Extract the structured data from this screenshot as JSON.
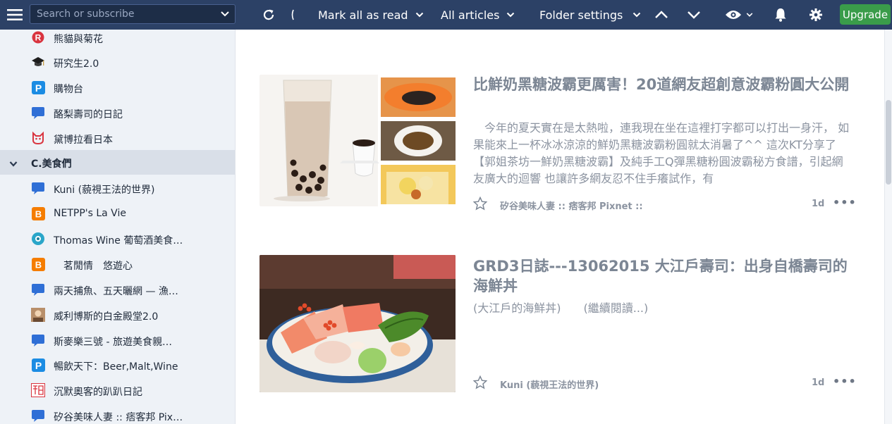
{
  "toolbar": {
    "search_placeholder": "Search or subscribe",
    "mark_all_read": "Mark all as read",
    "all_articles": "All articles",
    "folder_settings": "Folder settings",
    "upgrade": "Upgrade",
    "icons": [
      "hamburger-icon",
      "refresh-icon",
      "chevron-up-icon",
      "chevron-down-icon",
      "eye-icon",
      "bell-icon",
      "gear-icon"
    ],
    "upgrade_color": "#3a9c4a",
    "bar_color": "#2c4166"
  },
  "sidebar": {
    "feeds_before": [
      {
        "label": "熊貓與菊花",
        "icon": "R"
      },
      {
        "label": "研究生2.0",
        "icon": "cap"
      },
      {
        "label": "購物台",
        "icon": "P"
      },
      {
        "label": "酪梨壽司的日記",
        "icon": "bubble"
      },
      {
        "label": "黛博拉看日本",
        "icon": "cat"
      }
    ],
    "folder": {
      "label": "C.美食們"
    },
    "feeds_after": [
      {
        "label": "Kuni (藐視王法的世界)",
        "icon": "bubble"
      },
      {
        "label": "NETPP's La Vie",
        "icon": "blogger"
      },
      {
        "label": "Thomas Wine 葡萄酒美食…",
        "icon": "wine"
      },
      {
        "label": "　茗閒情　悠遊心",
        "icon": "blogger"
      },
      {
        "label": "兩天捕魚、五天曬網 — 漁…",
        "icon": "bubble"
      },
      {
        "label": "威利博斯的白金殿堂2.0",
        "icon": "photo"
      },
      {
        "label": "斯麥樂三號 - 旅遊美食親…",
        "icon": "bubble"
      },
      {
        "label": "暢飲天下：Beer,Malt,Wine",
        "icon": "P"
      },
      {
        "label": "沉默奧客的趴趴日記",
        "icon": "seal"
      },
      {
        "label": "矽谷美味人妻 :: 痞客邦 Pix…",
        "icon": "bubble"
      }
    ]
  },
  "articles": [
    {
      "title": "比鮮奶黑糖波霸更厲害！20道網友超創意波霸粉圓大公開",
      "snippet": "　今年的夏天實在是太熱啦，連我現在坐在這裡打字都可以打出一身汗，  如果能來上一杯冰冰涼涼的鮮奶黑糖波霸粉圓就太消暑了^^  這次KT分享了【郭姐茶坊一鮮奶黑糖波霸】及純手工Q彈黑糖粉圓波霸秘方食譜，引起網友廣大的迴響  也讓許多網友忍不住手癢試作，有",
      "source": "矽谷美味人妻 :: 痞客邦 Pixnet ::",
      "date": "1d",
      "more": "•••"
    },
    {
      "title": "GRD3日誌---13062015 大江戶壽司：出身自橋壽司的海鮮丼",
      "snippet": "(大江戶的海鮮丼)　　(繼續閱讀...)",
      "source": "Kuni (藐視王法的世界)",
      "date": "1d",
      "more": "•••"
    }
  ]
}
